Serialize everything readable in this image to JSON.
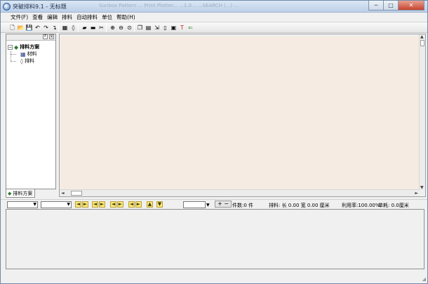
{
  "window": {
    "title": "突破排料9.1 - 无标题",
    "background_text": "Sunbox Pattern ...  Print Plotter...  ...1.0...  ...SEARCH (...) ...",
    "min_glyph": "─",
    "max_glyph": "□",
    "close_glyph": "✕"
  },
  "menu": {
    "items": [
      "文件(F)",
      "查看",
      "编辑",
      "排料",
      "自动排料",
      "单位",
      "帮助(H)"
    ]
  },
  "toolbar": {
    "buttons": [
      {
        "name": "new-file-icon",
        "glyph": "🗋"
      },
      {
        "name": "open-folder-icon",
        "glyph": "📂"
      },
      {
        "name": "save-icon",
        "glyph": "💾"
      },
      {
        "name": "undo-icon",
        "glyph": "↶"
      },
      {
        "name": "redo-icon",
        "glyph": "↷"
      },
      {
        "name": "rotate-icon",
        "glyph": "↴"
      },
      {
        "name": "grid-icon",
        "glyph": "▦"
      },
      {
        "name": "tag-icon",
        "glyph": "◊"
      },
      {
        "name": "layout-icon",
        "glyph": "▰"
      },
      {
        "name": "ruler-icon",
        "glyph": "▬"
      },
      {
        "name": "scissors-icon",
        "glyph": "✂"
      },
      {
        "name": "zoom-in-icon",
        "glyph": "⊕"
      },
      {
        "name": "zoom-out-icon",
        "glyph": "⊖"
      },
      {
        "name": "zoom-fit-icon",
        "glyph": "⊙"
      },
      {
        "name": "copy-icon",
        "glyph": "❐"
      },
      {
        "name": "pieces-icon",
        "glyph": "▤"
      },
      {
        "name": "export-icon",
        "glyph": "⇲"
      },
      {
        "name": "document-icon",
        "glyph": "▯"
      },
      {
        "name": "picture-icon",
        "glyph": "▣"
      },
      {
        "name": "text-icon",
        "glyph": "T"
      },
      {
        "name": "exit-icon",
        "glyph": "⇐"
      }
    ]
  },
  "tree": {
    "root_toggle": "−",
    "root": "排料方案",
    "children": [
      "材料",
      "排料"
    ],
    "tab_label": "排料方案"
  },
  "panel": {
    "pin_glyph": "┘",
    "close_glyph": "×"
  },
  "scroll": {
    "up": "▲",
    "down": "▼",
    "left": "◄",
    "right": "►"
  },
  "statusbar": {
    "combo_arrow": "▼",
    "nav_buttons": [
      "◄",
      "►",
      "◄",
      "►",
      "◄",
      "►",
      "◄",
      "►",
      "▲",
      "▼"
    ],
    "zoom_controls": "+ −",
    "count": "件数:0 件",
    "layout": "排料: 长 0.00 宽 0.00 厘米",
    "utilization": "利用率:100.00%",
    "consumption": "单耗: 0.0厘米"
  },
  "colors": {
    "canvas": "#f6ebe2",
    "titlebar": "#bcd0e8",
    "button_yellow": "#fde77a"
  }
}
